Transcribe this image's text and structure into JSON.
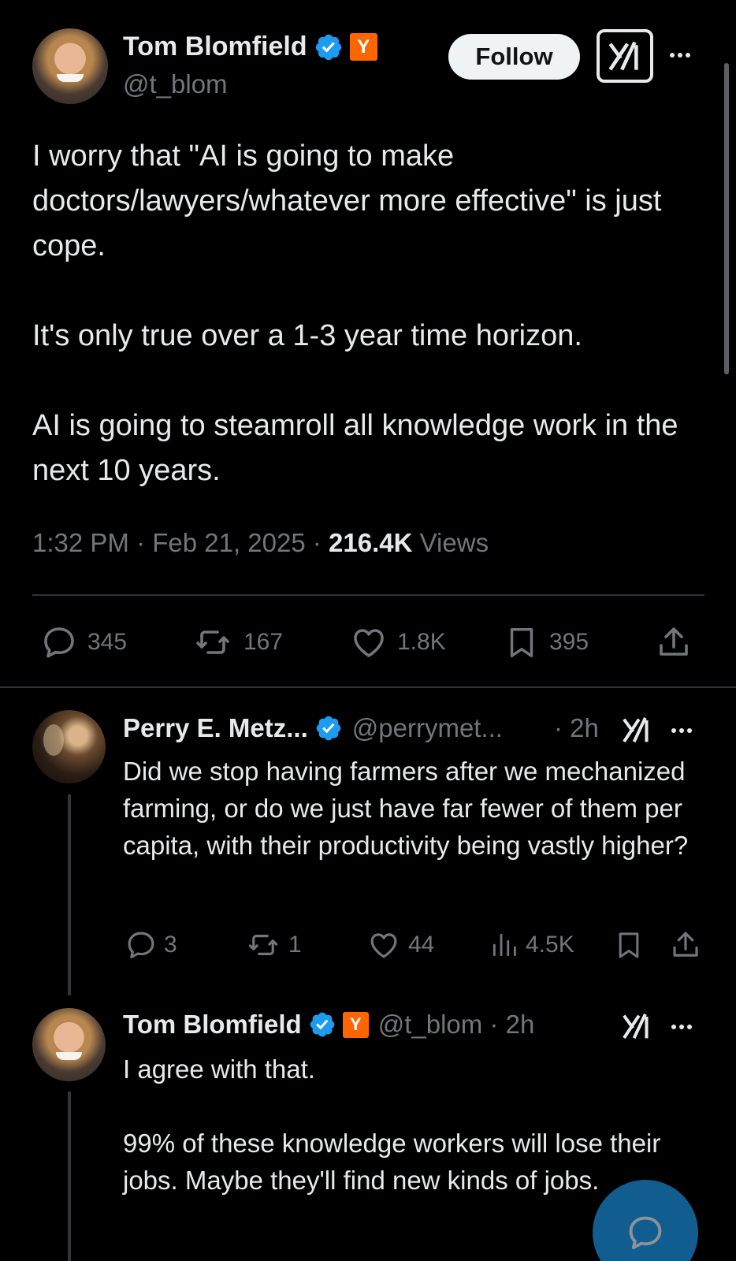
{
  "main_tweet": {
    "author_name": "Tom Blomfield",
    "handle": "@t_blom",
    "badge": "Y",
    "follow_label": "Follow",
    "text": "I worry that \"AI is going to make doctors/lawyers/whatever more effective\" is just cope.\n\nIt's only true over a 1-3 year time horizon.\n\nAI is going to steamroll all knowledge work in the next 10 years.",
    "time": "1:32 PM · Feb 21, 2025 · ",
    "views_count": "216.4K",
    "views_label": " Views",
    "stats": {
      "replies": "345",
      "reposts": "167",
      "likes": "1.8K",
      "bookmarks": "395"
    }
  },
  "reply_1": {
    "author_name": "Perry E. Metz...",
    "handle": "@perrymet...",
    "time": "· 2h",
    "text": "Did we stop having farmers after we mechanized farming, or do we just have far fewer of them per capita, with their productivity being vastly higher?",
    "stats": {
      "replies": "3",
      "reposts": "1",
      "likes": "44",
      "views": "4.5K"
    }
  },
  "reply_2": {
    "author_name": "Tom Blomfield",
    "badge": "Y",
    "handle_time": "@t_blom · 2h",
    "text": "I agree with that.\n\n99% of these knowledge workers will lose their jobs. Maybe they'll find new kinds of jobs."
  },
  "colors": {
    "background": "#000000",
    "text": "#e7e9ea",
    "muted": "#71767b",
    "verified": "#1d9bf0",
    "ycombinator": "#ff6600"
  },
  "icons": [
    "verified-icon",
    "grok-icon",
    "more-icon",
    "reply-icon",
    "repost-icon",
    "like-icon",
    "bookmark-icon",
    "share-icon",
    "views-icon",
    "compose-icon"
  ]
}
